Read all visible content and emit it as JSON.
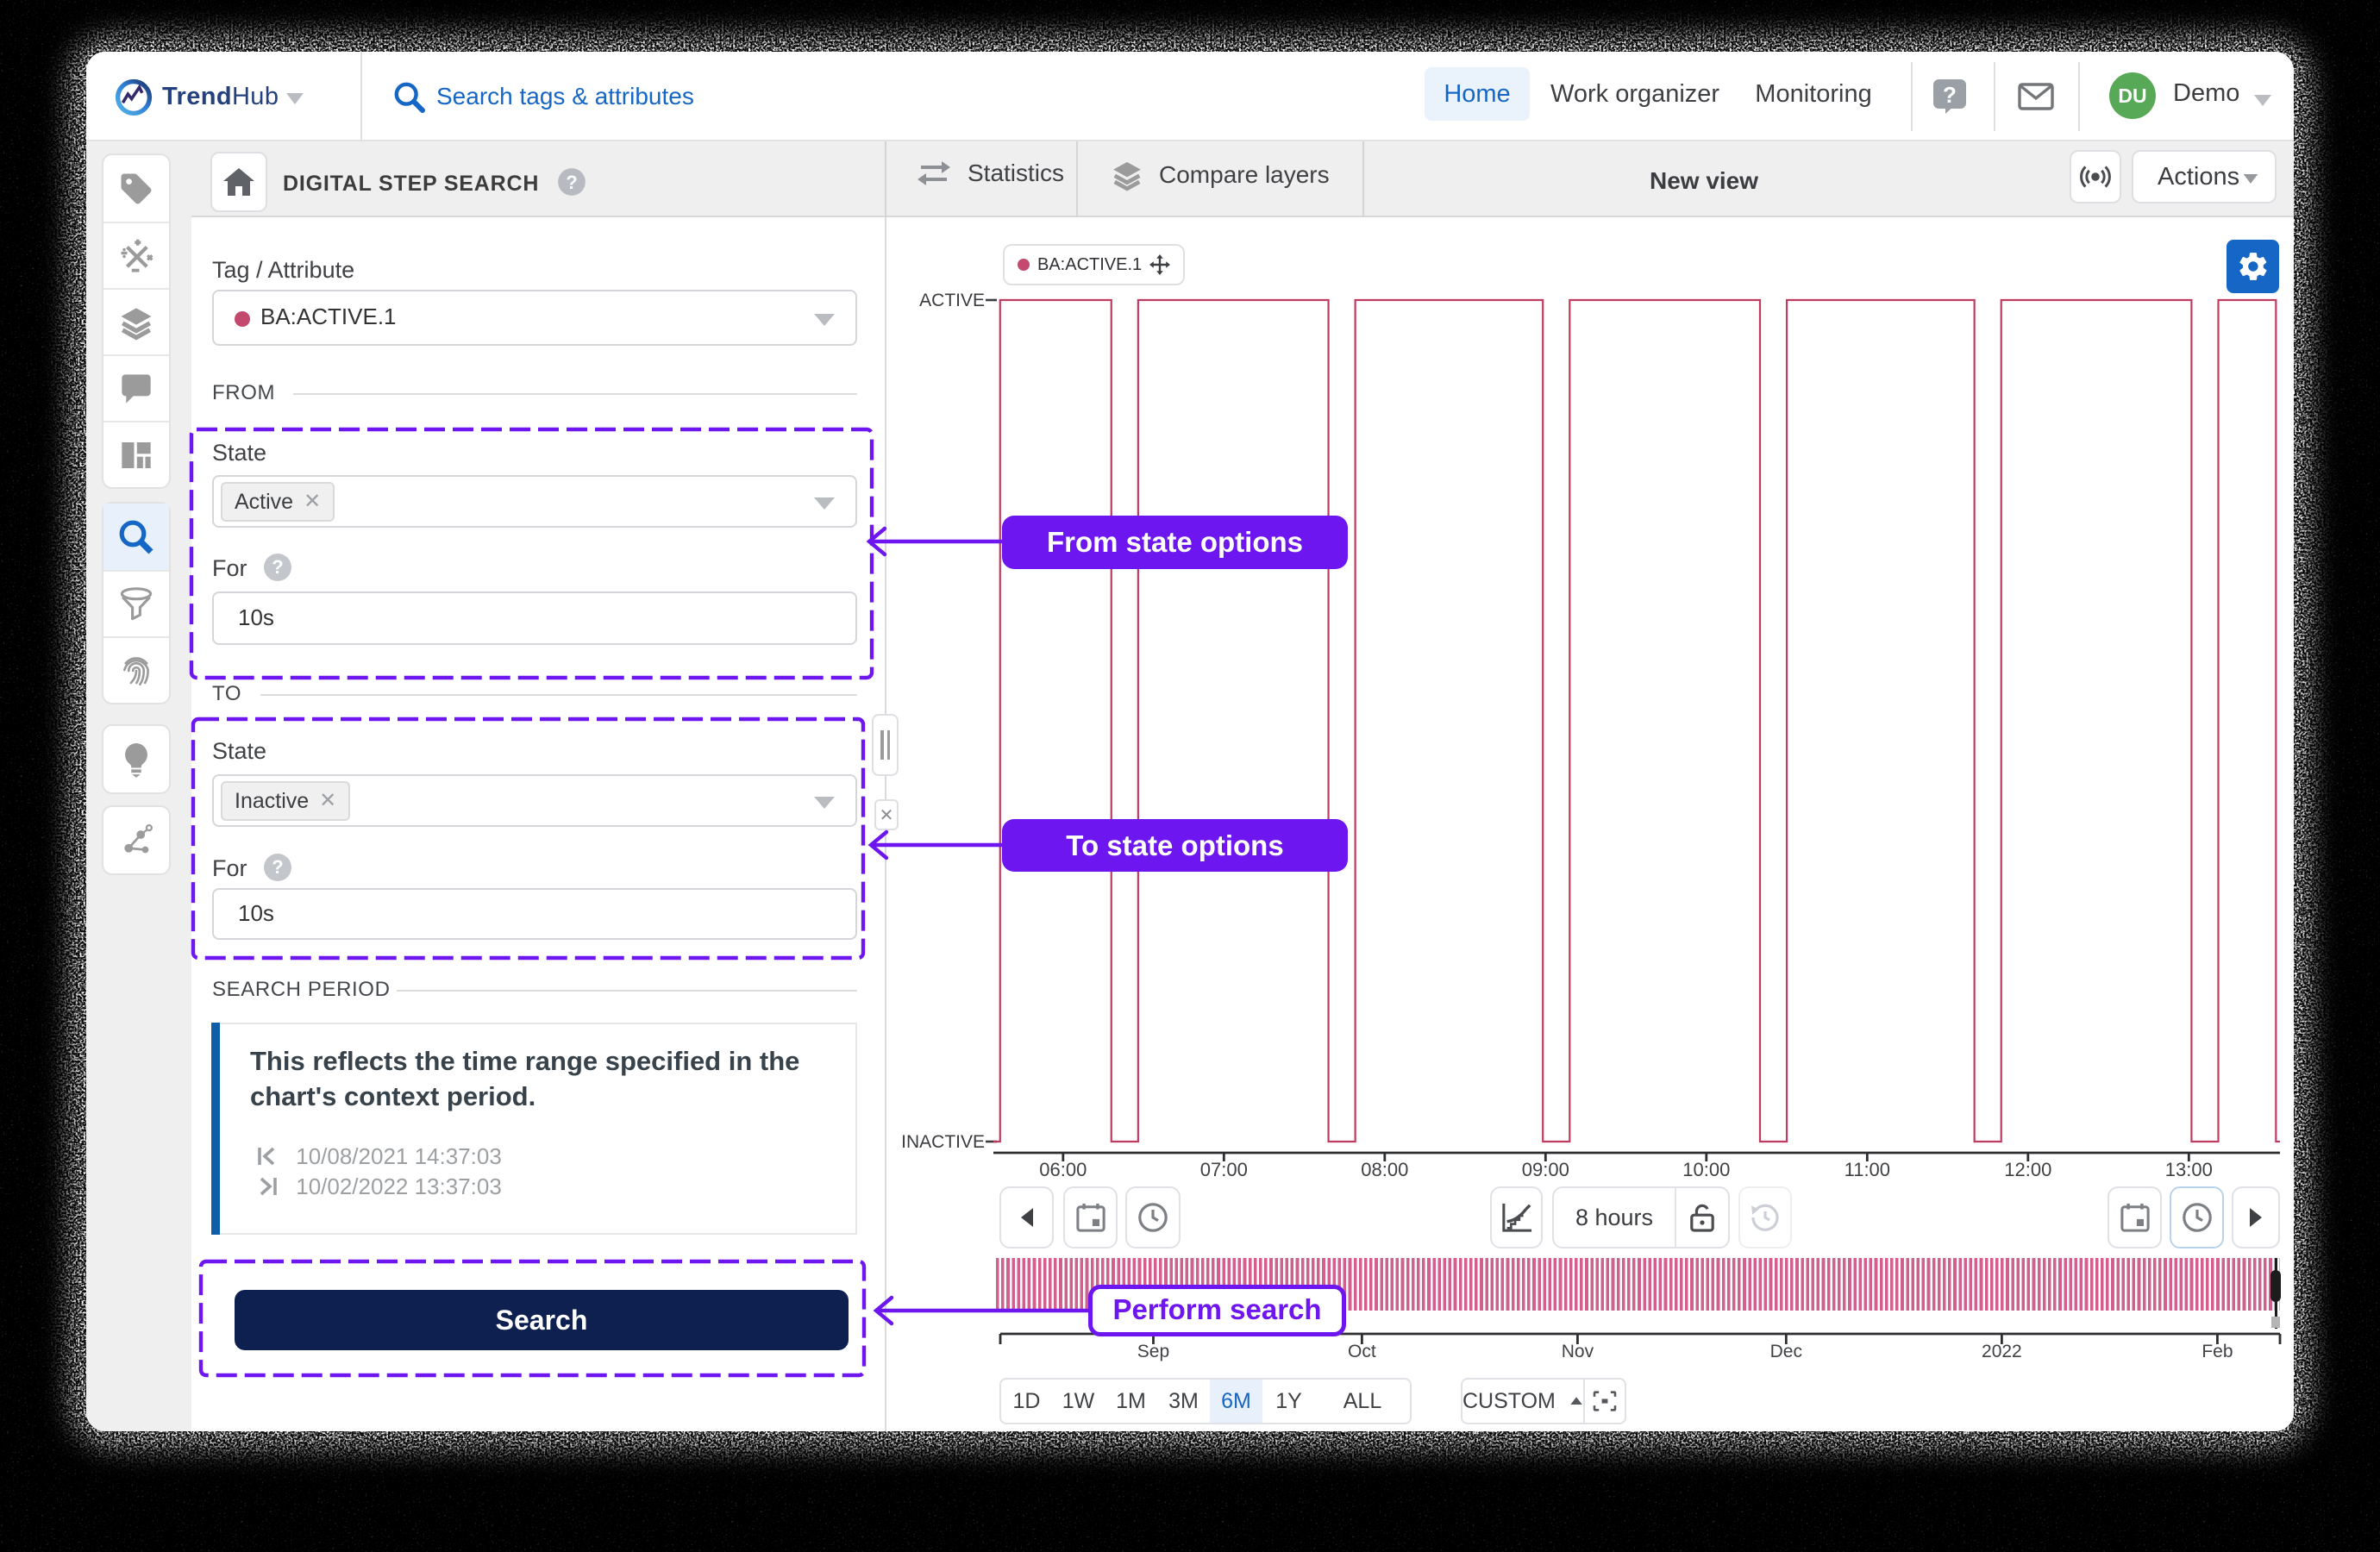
{
  "colors": {
    "blue": "#1666c5",
    "purple": "#6d16f0",
    "navy_button": "#0d2050",
    "wave": "#c03b60",
    "dot_red": "#c4496e",
    "stripe": "#d2608f",
    "avatar_green": "#57a857",
    "card_accent": "#0e5fa8",
    "brand_navy": "#24417f"
  },
  "navbar": {
    "brand": "TrendHub",
    "brand_bold": "Trend",
    "brand_light": "Hub",
    "search_placeholder": "Search tags & attributes",
    "items": [
      {
        "label": "Home",
        "active": true
      },
      {
        "label": "Work organizer",
        "active": false
      },
      {
        "label": "Monitoring",
        "active": false
      }
    ],
    "user": {
      "initials": "DU",
      "name": "Demo"
    }
  },
  "toolbar": {
    "title": "DIGITAL STEP SEARCH",
    "tabs": [
      {
        "label": "Statistics"
      },
      {
        "label": "Compare layers"
      }
    ],
    "view_title": "New view",
    "actions_label": "Actions"
  },
  "sidebar": {
    "icons": [
      "tags",
      "formulas",
      "layers",
      "comments",
      "dashboards",
      "search",
      "filter",
      "fingerprint",
      "ideas",
      "machine-learning"
    ],
    "active": "search"
  },
  "form": {
    "tag_attribute_label": "Tag / Attribute",
    "tag_attribute_value": "BA:ACTIVE.1",
    "from": {
      "heading": "FROM",
      "state_label": "State",
      "state_value": "Active",
      "for_label": "For",
      "for_value": "10s"
    },
    "to": {
      "heading": "TO",
      "state_label": "State",
      "state_value": "Inactive",
      "for_label": "For",
      "for_value": "10s"
    },
    "search_period": {
      "heading": "SEARCH PERIOD",
      "note": "This reflects the time range specified in the chart's context period.",
      "note_line1": "This reflects the time range specified in the",
      "note_line2": "chart's context period.",
      "start": "10/08/2021 14:37:03",
      "end": "10/02/2022 13:37:03"
    },
    "search_button": "Search"
  },
  "annotations": {
    "from_label": "From state options",
    "to_label": "To state options",
    "perform_label": "Perform search"
  },
  "chart_data": {
    "type": "line",
    "style": "digital-step",
    "series": [
      {
        "name": "BA:ACTIVE.1",
        "color": "#c03b60"
      }
    ],
    "ylabel": "",
    "xlabel": "",
    "y_categories": [
      "ACTIVE",
      "INACTIVE"
    ],
    "x_ticks": [
      "06:00",
      "07:00",
      "08:00",
      "09:00",
      "10:00",
      "11:00",
      "12:00",
      "13:00"
    ],
    "x_tick_start_min": 360,
    "x_tick_step_min": 60,
    "time_start_min": 334,
    "time_end_min": 814,
    "window_label": "8 hours",
    "low_intervals_min": [
      [
        334,
        336.5
      ],
      [
        378,
        388
      ],
      [
        459,
        469
      ],
      [
        539,
        549
      ],
      [
        620,
        630
      ],
      [
        700,
        710
      ],
      [
        781,
        791
      ],
      [
        812.5,
        814
      ]
    ],
    "legend": {
      "name": "BA:ACTIVE.1"
    },
    "grid": false,
    "overview": {
      "months": [
        {
          "label": "Sep",
          "f": 0.1196
        },
        {
          "label": "Oct",
          "f": 0.2826
        },
        {
          "label": "Nov",
          "f": 0.4511
        },
        {
          "label": "Dec",
          "f": 0.6141
        },
        {
          "label": "2022",
          "f": 0.7826
        },
        {
          "label": "Feb",
          "f": 0.9511
        }
      ]
    }
  },
  "chart_toolbar": {
    "duration": "8 hours"
  },
  "timeline": {
    "range_buttons": [
      "1D",
      "1W",
      "1M",
      "3M",
      "6M",
      "1Y",
      "ALL"
    ],
    "active_range": "6M",
    "custom_label": "CUSTOM"
  }
}
